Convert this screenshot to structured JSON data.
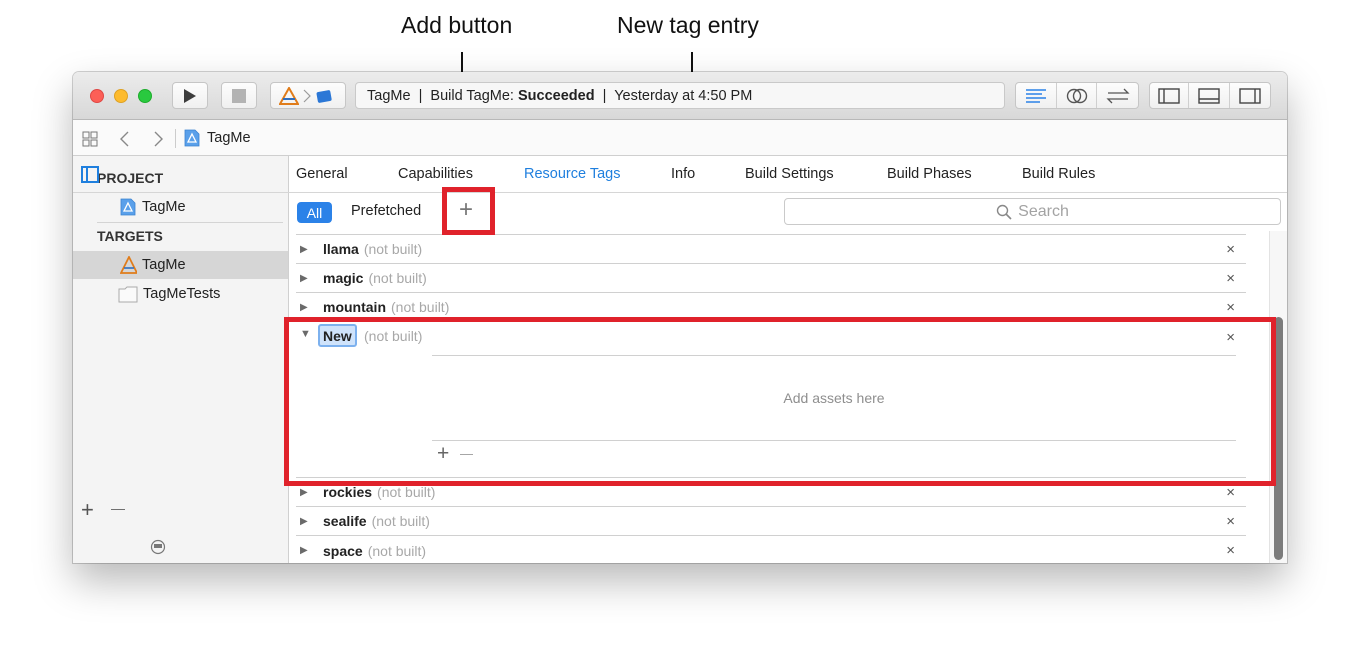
{
  "annotations": {
    "add_button_label": "Add button",
    "new_tag_label": "New tag entry",
    "highlight_color": "#e0222b"
  },
  "toolbar": {
    "scheme_icons": [
      "xcode-app-icon",
      "chevron-right-icon",
      "ios-device-icon"
    ],
    "activity_prefix": "TagMe  |  Build TagMe: ",
    "activity_status": "Succeeded",
    "activity_suffix": "  |  Yesterday at 4:50 PM",
    "right_buttons": [
      "standard-editor-icon",
      "assistant-editor-icon",
      "version-editor-icon",
      "navigator-toggle-icon",
      "debug-area-toggle-icon",
      "utilities-toggle-icon"
    ]
  },
  "jumpbar": {
    "breadcrumb": "TagMe"
  },
  "editor_tabs": {
    "items": [
      "General",
      "Capabilities",
      "Resource Tags",
      "Info",
      "Build Settings",
      "Build Phases",
      "Build Rules"
    ],
    "active": "Resource Tags"
  },
  "filters": {
    "all_label": "All",
    "prefetched_label": "Prefetched",
    "add_symbol": "+",
    "search_placeholder": "Search"
  },
  "sidebar": {
    "project_heading": "PROJECT",
    "project_item": "TagMe",
    "targets_heading": "TARGETS",
    "targets": [
      "TagMe",
      "TagMeTests"
    ],
    "add_symbol": "+",
    "remove_symbol": "—"
  },
  "tags": {
    "state_label": "(not built)",
    "delete_symbol": "×",
    "rows_before": [
      "llama",
      "magic",
      "mountain"
    ],
    "expanded": {
      "name": "New",
      "empty_message": "Add assets here",
      "add_symbol": "+",
      "remove_symbol": "—"
    },
    "rows_after": [
      "rockies",
      "sealife",
      "space"
    ]
  }
}
